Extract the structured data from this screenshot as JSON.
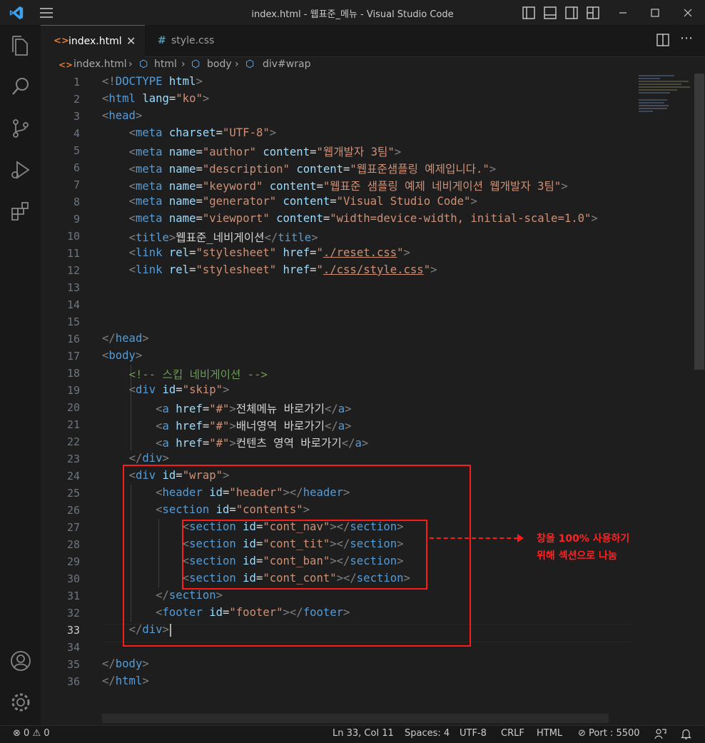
{
  "window": {
    "title": "index.html - 웹표준_메뉴 - Visual Studio Code"
  },
  "tabs": [
    {
      "label": "index.html",
      "icon": "html-file-icon",
      "active": true
    },
    {
      "label": "style.css",
      "icon": "css-file-icon",
      "active": false
    }
  ],
  "breadcrumb": [
    "index.html",
    "html",
    "body",
    "div#wrap"
  ],
  "editor": {
    "line_numbers": [
      "1",
      "2",
      "3",
      "4",
      "5",
      "6",
      "7",
      "8",
      "9",
      "10",
      "11",
      "12",
      "13",
      "14",
      "15",
      "16",
      "17",
      "18",
      "19",
      "20",
      "21",
      "22",
      "23",
      "24",
      "25",
      "26",
      "27",
      "28",
      "29",
      "30",
      "31",
      "32",
      "33",
      "34",
      "35",
      "36"
    ],
    "current_line": "33",
    "lines": [
      [
        [
          "p",
          "<!"
        ],
        [
          "t",
          "DOCTYPE"
        ],
        [
          "x",
          " "
        ],
        [
          "a",
          "html"
        ],
        [
          "p",
          ">"
        ]
      ],
      [
        [
          "p",
          "<"
        ],
        [
          "t",
          "html"
        ],
        [
          "x",
          " "
        ],
        [
          "a",
          "lang"
        ],
        [
          "x",
          "="
        ],
        [
          "v",
          "\"ko\""
        ],
        [
          "p",
          ">"
        ]
      ],
      [
        [
          "p",
          "<"
        ],
        [
          "t",
          "head"
        ],
        [
          "p",
          ">"
        ]
      ],
      [
        [
          "x",
          "    "
        ],
        [
          "p",
          "<"
        ],
        [
          "t",
          "meta"
        ],
        [
          "x",
          " "
        ],
        [
          "a",
          "charset"
        ],
        [
          "x",
          "="
        ],
        [
          "v",
          "\"UTF-8\""
        ],
        [
          "p",
          ">"
        ]
      ],
      [
        [
          "x",
          "    "
        ],
        [
          "p",
          "<"
        ],
        [
          "t",
          "meta"
        ],
        [
          "x",
          " "
        ],
        [
          "a",
          "name"
        ],
        [
          "x",
          "="
        ],
        [
          "v",
          "\"author\""
        ],
        [
          "x",
          " "
        ],
        [
          "a",
          "content"
        ],
        [
          "x",
          "="
        ],
        [
          "v",
          "\"웹개발자 3팀\""
        ],
        [
          "p",
          ">"
        ]
      ],
      [
        [
          "x",
          "    "
        ],
        [
          "p",
          "<"
        ],
        [
          "t",
          "meta"
        ],
        [
          "x",
          " "
        ],
        [
          "a",
          "name"
        ],
        [
          "x",
          "="
        ],
        [
          "v",
          "\"description\""
        ],
        [
          "x",
          " "
        ],
        [
          "a",
          "content"
        ],
        [
          "x",
          "="
        ],
        [
          "v",
          "\"웹표준샘플링 예제입니다.\""
        ],
        [
          "p",
          ">"
        ]
      ],
      [
        [
          "x",
          "    "
        ],
        [
          "p",
          "<"
        ],
        [
          "t",
          "meta"
        ],
        [
          "x",
          " "
        ],
        [
          "a",
          "name"
        ],
        [
          "x",
          "="
        ],
        [
          "v",
          "\"keyword\""
        ],
        [
          "x",
          " "
        ],
        [
          "a",
          "content"
        ],
        [
          "x",
          "="
        ],
        [
          "v",
          "\"웹표준 샘플링 예제 네비게이션 웹개발자 3팀\""
        ],
        [
          "p",
          ">"
        ]
      ],
      [
        [
          "x",
          "    "
        ],
        [
          "p",
          "<"
        ],
        [
          "t",
          "meta"
        ],
        [
          "x",
          " "
        ],
        [
          "a",
          "name"
        ],
        [
          "x",
          "="
        ],
        [
          "v",
          "\"generator\""
        ],
        [
          "x",
          " "
        ],
        [
          "a",
          "content"
        ],
        [
          "x",
          "="
        ],
        [
          "v",
          "\"Visual Studio Code\""
        ],
        [
          "p",
          ">"
        ]
      ],
      [
        [
          "x",
          "    "
        ],
        [
          "p",
          "<"
        ],
        [
          "t",
          "meta"
        ],
        [
          "x",
          " "
        ],
        [
          "a",
          "name"
        ],
        [
          "x",
          "="
        ],
        [
          "v",
          "\"viewport\""
        ],
        [
          "x",
          " "
        ],
        [
          "a",
          "content"
        ],
        [
          "x",
          "="
        ],
        [
          "v",
          "\"width=device-width, initial-scale=1.0\""
        ],
        [
          "p",
          ">"
        ]
      ],
      [
        [
          "x",
          "    "
        ],
        [
          "p",
          "<"
        ],
        [
          "t",
          "title"
        ],
        [
          "p",
          ">"
        ],
        [
          "x",
          "웹표준_네비게이션"
        ],
        [
          "p",
          "</"
        ],
        [
          "t",
          "title"
        ],
        [
          "p",
          ">"
        ]
      ],
      [
        [
          "x",
          "    "
        ],
        [
          "p",
          "<"
        ],
        [
          "t",
          "link"
        ],
        [
          "x",
          " "
        ],
        [
          "a",
          "rel"
        ],
        [
          "x",
          "="
        ],
        [
          "v",
          "\"stylesheet\""
        ],
        [
          "x",
          " "
        ],
        [
          "a",
          "href"
        ],
        [
          "x",
          "="
        ],
        [
          "v",
          "\""
        ],
        [
          "u",
          "./reset.css"
        ],
        [
          "v",
          "\""
        ],
        [
          "p",
          ">"
        ]
      ],
      [
        [
          "x",
          "    "
        ],
        [
          "p",
          "<"
        ],
        [
          "t",
          "link"
        ],
        [
          "x",
          " "
        ],
        [
          "a",
          "rel"
        ],
        [
          "x",
          "="
        ],
        [
          "v",
          "\"stylesheet\""
        ],
        [
          "x",
          " "
        ],
        [
          "a",
          "href"
        ],
        [
          "x",
          "="
        ],
        [
          "v",
          "\""
        ],
        [
          "u",
          "./css/style.css"
        ],
        [
          "v",
          "\""
        ],
        [
          "p",
          ">"
        ]
      ],
      [],
      [],
      [],
      [
        [
          "p",
          "</"
        ],
        [
          "t",
          "head"
        ],
        [
          "p",
          ">"
        ]
      ],
      [
        [
          "p",
          "<"
        ],
        [
          "t",
          "body"
        ],
        [
          "p",
          ">"
        ]
      ],
      [
        [
          "x",
          "    "
        ],
        [
          "c",
          "<!-- 스킵 네비게이션 -->"
        ]
      ],
      [
        [
          "x",
          "    "
        ],
        [
          "p",
          "<"
        ],
        [
          "t",
          "div"
        ],
        [
          "x",
          " "
        ],
        [
          "a",
          "id"
        ],
        [
          "x",
          "="
        ],
        [
          "v",
          "\"skip\""
        ],
        [
          "p",
          ">"
        ]
      ],
      [
        [
          "x",
          "        "
        ],
        [
          "p",
          "<"
        ],
        [
          "t",
          "a"
        ],
        [
          "x",
          " "
        ],
        [
          "a",
          "href"
        ],
        [
          "x",
          "="
        ],
        [
          "v",
          "\"#\""
        ],
        [
          "p",
          ">"
        ],
        [
          "x",
          "전체메뉴 바로가기"
        ],
        [
          "p",
          "</"
        ],
        [
          "t",
          "a"
        ],
        [
          "p",
          ">"
        ]
      ],
      [
        [
          "x",
          "        "
        ],
        [
          "p",
          "<"
        ],
        [
          "t",
          "a"
        ],
        [
          "x",
          " "
        ],
        [
          "a",
          "href"
        ],
        [
          "x",
          "="
        ],
        [
          "v",
          "\"#\""
        ],
        [
          "p",
          ">"
        ],
        [
          "x",
          "배너영역 바로가기"
        ],
        [
          "p",
          "</"
        ],
        [
          "t",
          "a"
        ],
        [
          "p",
          ">"
        ]
      ],
      [
        [
          "x",
          "        "
        ],
        [
          "p",
          "<"
        ],
        [
          "t",
          "a"
        ],
        [
          "x",
          " "
        ],
        [
          "a",
          "href"
        ],
        [
          "x",
          "="
        ],
        [
          "v",
          "\"#\""
        ],
        [
          "p",
          ">"
        ],
        [
          "x",
          "컨텐츠 영역 바로가기"
        ],
        [
          "p",
          "</"
        ],
        [
          "t",
          "a"
        ],
        [
          "p",
          ">"
        ]
      ],
      [
        [
          "x",
          "    "
        ],
        [
          "p",
          "</"
        ],
        [
          "t",
          "div"
        ],
        [
          "p",
          ">"
        ]
      ],
      [
        [
          "x",
          "    "
        ],
        [
          "p",
          "<"
        ],
        [
          "t",
          "div"
        ],
        [
          "x",
          " "
        ],
        [
          "a",
          "id"
        ],
        [
          "x",
          "="
        ],
        [
          "v",
          "\"wrap\""
        ],
        [
          "p",
          ">"
        ]
      ],
      [
        [
          "x",
          "        "
        ],
        [
          "p",
          "<"
        ],
        [
          "t",
          "header"
        ],
        [
          "x",
          " "
        ],
        [
          "a",
          "id"
        ],
        [
          "x",
          "="
        ],
        [
          "v",
          "\"header\""
        ],
        [
          "p",
          "></"
        ],
        [
          "t",
          "header"
        ],
        [
          "p",
          ">"
        ]
      ],
      [
        [
          "x",
          "        "
        ],
        [
          "p",
          "<"
        ],
        [
          "t",
          "section"
        ],
        [
          "x",
          " "
        ],
        [
          "a",
          "id"
        ],
        [
          "x",
          "="
        ],
        [
          "v",
          "\"contents\""
        ],
        [
          "p",
          ">"
        ]
      ],
      [
        [
          "x",
          "            "
        ],
        [
          "p",
          "<"
        ],
        [
          "t",
          "section"
        ],
        [
          "x",
          " "
        ],
        [
          "a",
          "id"
        ],
        [
          "x",
          "="
        ],
        [
          "v",
          "\"cont_nav\""
        ],
        [
          "p",
          "></"
        ],
        [
          "t",
          "section"
        ],
        [
          "p",
          ">"
        ]
      ],
      [
        [
          "x",
          "            "
        ],
        [
          "p",
          "<"
        ],
        [
          "t",
          "section"
        ],
        [
          "x",
          " "
        ],
        [
          "a",
          "id"
        ],
        [
          "x",
          "="
        ],
        [
          "v",
          "\"cont_tit\""
        ],
        [
          "p",
          "></"
        ],
        [
          "t",
          "section"
        ],
        [
          "p",
          ">"
        ]
      ],
      [
        [
          "x",
          "            "
        ],
        [
          "p",
          "<"
        ],
        [
          "t",
          "section"
        ],
        [
          "x",
          " "
        ],
        [
          "a",
          "id"
        ],
        [
          "x",
          "="
        ],
        [
          "v",
          "\"cont_ban\""
        ],
        [
          "p",
          "></"
        ],
        [
          "t",
          "section"
        ],
        [
          "p",
          ">"
        ]
      ],
      [
        [
          "x",
          "            "
        ],
        [
          "p",
          "<"
        ],
        [
          "t",
          "section"
        ],
        [
          "x",
          " "
        ],
        [
          "a",
          "id"
        ],
        [
          "x",
          "="
        ],
        [
          "v",
          "\"cont_cont\""
        ],
        [
          "p",
          "></"
        ],
        [
          "t",
          "section"
        ],
        [
          "p",
          ">"
        ]
      ],
      [
        [
          "x",
          "        "
        ],
        [
          "p",
          "</"
        ],
        [
          "t",
          "section"
        ],
        [
          "p",
          ">"
        ]
      ],
      [
        [
          "x",
          "        "
        ],
        [
          "p",
          "<"
        ],
        [
          "t",
          "footer"
        ],
        [
          "x",
          " "
        ],
        [
          "a",
          "id"
        ],
        [
          "x",
          "="
        ],
        [
          "v",
          "\"footer\""
        ],
        [
          "p",
          "></"
        ],
        [
          "t",
          "footer"
        ],
        [
          "p",
          ">"
        ]
      ],
      [
        [
          "x",
          "    "
        ],
        [
          "p",
          "</"
        ],
        [
          "t",
          "div"
        ],
        [
          "p",
          ">"
        ]
      ],
      [],
      [
        [
          "p",
          "</"
        ],
        [
          "t",
          "body"
        ],
        [
          "p",
          ">"
        ]
      ],
      [
        [
          "p",
          "</"
        ],
        [
          "t",
          "html"
        ],
        [
          "p",
          ">"
        ]
      ]
    ]
  },
  "annotation": {
    "line1": "창을 100% 사용하기",
    "line2": "위해 섹션으로 나눔",
    "color": "#ff2222"
  },
  "statusbar": {
    "errors": "0",
    "warnings": "0",
    "position": "Ln 33, Col 11",
    "spaces": "Spaces: 4",
    "encoding": "UTF-8",
    "eol": "CRLF",
    "language": "HTML",
    "port": "Port : 5500"
  },
  "colors": {
    "accent": "#0078d4",
    "tag": "#569cd6",
    "attr": "#9cdcfe",
    "string": "#ce9178",
    "comment": "#6a9955"
  }
}
